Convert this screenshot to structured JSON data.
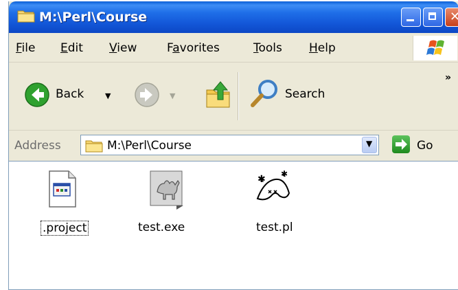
{
  "window": {
    "title": "M:\\Perl\\Course"
  },
  "menu": {
    "items": [
      "File",
      "Edit",
      "View",
      "Favorites",
      "Tools",
      "Help"
    ],
    "underline": [
      "F",
      "E",
      "V",
      "a",
      "T",
      "H"
    ]
  },
  "toolbar": {
    "back_label": "Back",
    "search_label": "Search",
    "more_glyph": "»"
  },
  "address": {
    "label": "Address",
    "value": "M:\\Perl\\Course",
    "go_label": "Go"
  },
  "files": [
    {
      "name": ".project",
      "icon": "project-file-icon",
      "selected": true
    },
    {
      "name": "test.exe",
      "icon": "camel-exe-icon",
      "selected": false
    },
    {
      "name": "test.pl",
      "icon": "perl-script-icon",
      "selected": false
    }
  ],
  "colors": {
    "titlebar": "#0c47c5",
    "chrome": "#ece9d8",
    "go_green": "#1e8a1e",
    "back_green": "#2fa12f"
  }
}
